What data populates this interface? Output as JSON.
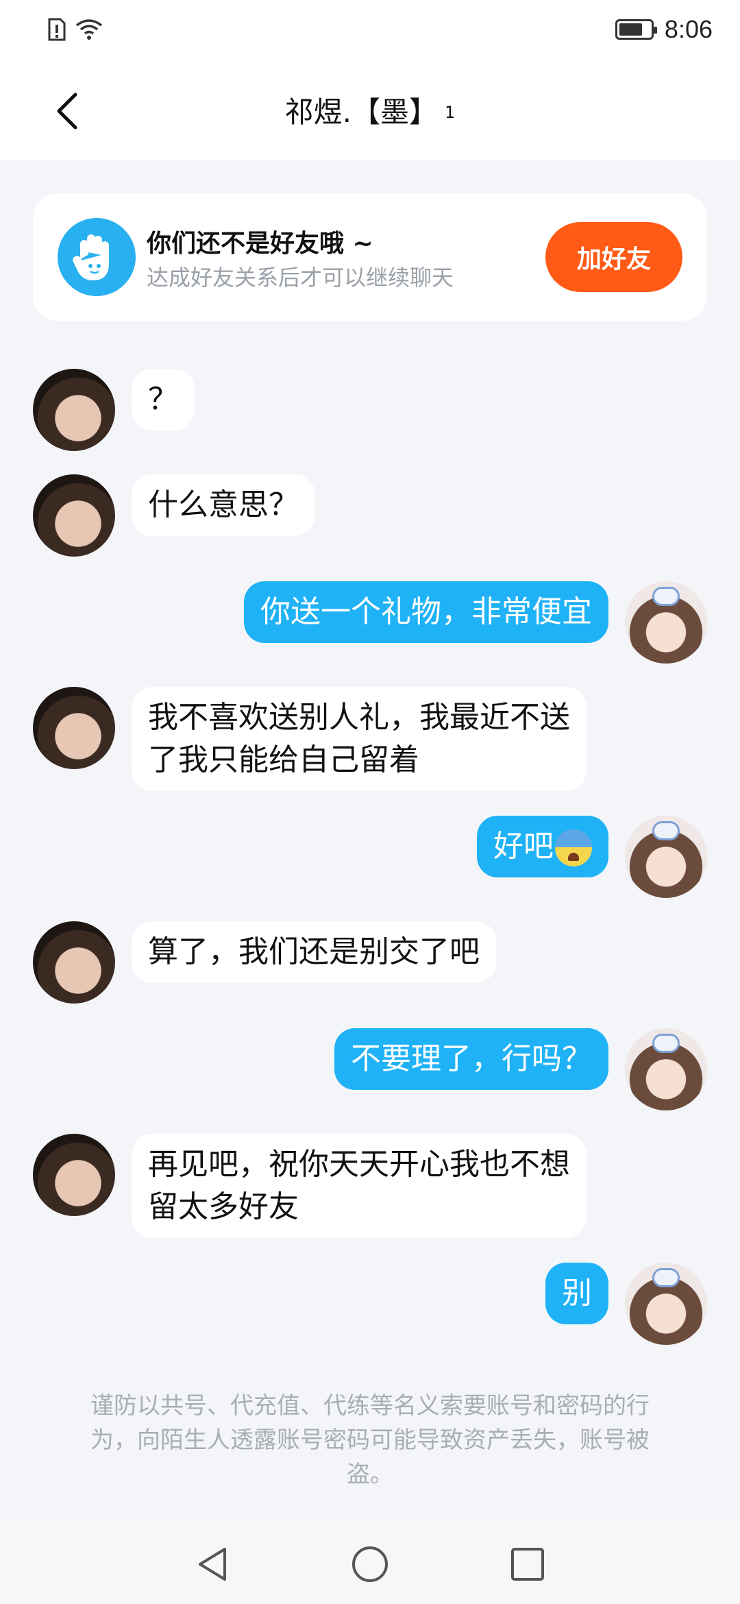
{
  "status_bar": {
    "time": "8:06",
    "icons": [
      "sim-alert-icon",
      "wifi-icon",
      "battery-icon"
    ],
    "battery_level": 0.75
  },
  "header": {
    "title": "祁煜.【墨】",
    "superscript": "1",
    "back_icon": "chevron-left-icon"
  },
  "friend_banner": {
    "title": "你们还不是好友哦 ~",
    "subtitle": "达成好友关系后才可以继续聊天",
    "button_label": "加好友",
    "icon": "waving-hand-icon"
  },
  "messages": [
    {
      "sender": "other",
      "text": "？"
    },
    {
      "sender": "other",
      "text": "什么意思？"
    },
    {
      "sender": "me",
      "text": "你送一个礼物，非常便宜"
    },
    {
      "sender": "other",
      "line1": "我不喜欢送别人礼，我最近不送",
      "line2": "了我只能给自己留着"
    },
    {
      "sender": "me",
      "text": "好吧",
      "emoji": "anxious-sweat-emoji"
    },
    {
      "sender": "other",
      "text": "算了，我们还是别交了吧"
    },
    {
      "sender": "me",
      "text": "不要理了，行吗？"
    },
    {
      "sender": "other",
      "line1": "再见吧，祝你天天开心我也不想",
      "line2": "留太多好友"
    },
    {
      "sender": "me",
      "text": "别"
    }
  ],
  "notice": "谨防以共号、代充值、代练等名义索要账号和密码的行为，向陌生人透露账号密码可能导致资产丢失，账号被盗。",
  "nav_bar": {
    "icons": [
      "nav-back-icon",
      "nav-home-icon",
      "nav-recent-icon"
    ]
  },
  "colors": {
    "accent_blue": "#1fb2f7",
    "add_friend_orange": "#ff5a16",
    "background": "#f3f5f9"
  }
}
